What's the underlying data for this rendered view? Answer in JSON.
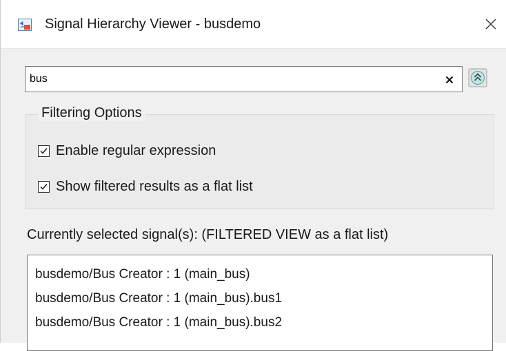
{
  "window": {
    "title": "Signal Hierarchy Viewer - busdemo",
    "close_glyph": "✕"
  },
  "search": {
    "value": "bus",
    "clear_glyph": "×"
  },
  "filtering": {
    "legend": "Filtering Options",
    "options": [
      {
        "label": "Enable regular expression",
        "checked": true
      },
      {
        "label": "Show filtered results as a flat list",
        "checked": true
      }
    ]
  },
  "signals": {
    "heading": "Currently selected signal(s): (FILTERED VIEW as a flat list)",
    "items": [
      "busdemo/Bus Creator : 1 (main_bus)",
      "busdemo/Bus Creator : 1 (main_bus).bus1",
      "busdemo/Bus Creator : 1 (main_bus).bus2"
    ]
  },
  "colors": {
    "window_bg": "#f0f0f0",
    "group_bg": "#ebebeb",
    "input_border": "#7a7a7a",
    "collapse_button": "#7fc6bd"
  },
  "icons": {
    "app": "simulink-app-icon",
    "close": "close-icon",
    "clear": "clear-search-icon",
    "collapse": "collapse-up-icon",
    "checkbox": "checkmark-icon"
  }
}
